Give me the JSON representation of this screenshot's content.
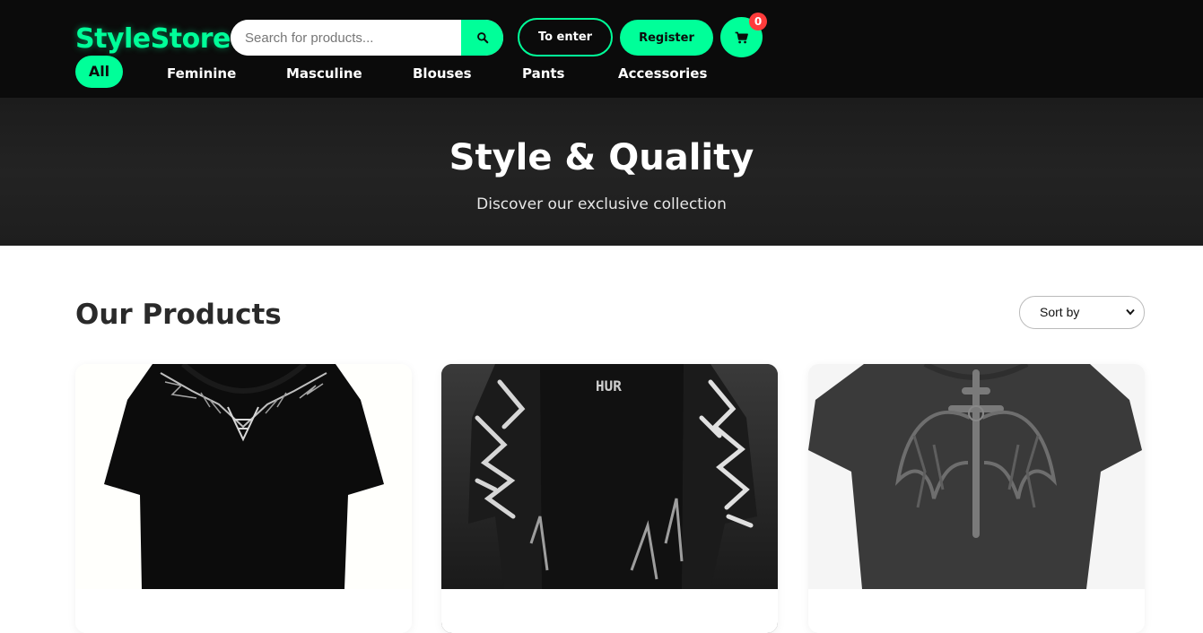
{
  "header": {
    "logo": "StyleStore",
    "search": {
      "placeholder": "Search for products...",
      "value": ""
    },
    "login_label": "To enter",
    "register_label": "Register",
    "cart_count": "0"
  },
  "nav": {
    "items": [
      {
        "label": "All",
        "active": true
      },
      {
        "label": "Feminine"
      },
      {
        "label": "Masculine"
      },
      {
        "label": "Blouses"
      },
      {
        "label": "Pants"
      },
      {
        "label": "Accessories"
      }
    ]
  },
  "hero": {
    "title": "Style & Quality",
    "subtitle": "Discover our exclusive collection"
  },
  "products": {
    "title": "Our Products",
    "sort": {
      "selected": "Sort by"
    },
    "items": [
      {
        "image": "black t-shirt with silver barbed chain print"
      },
      {
        "image": "black t-shirt with white flame sleeves"
      },
      {
        "image": "washed gray t-shirt with winged cross print"
      }
    ]
  },
  "colors": {
    "accent": "#00ff99",
    "header_bg": "#0b0b0b",
    "hero_bg": "#1f1f1f",
    "badge": "#ff3b3b"
  },
  "icons": {
    "search": "search-icon",
    "cart": "cart-icon",
    "sort": "chevron-down-icon"
  }
}
